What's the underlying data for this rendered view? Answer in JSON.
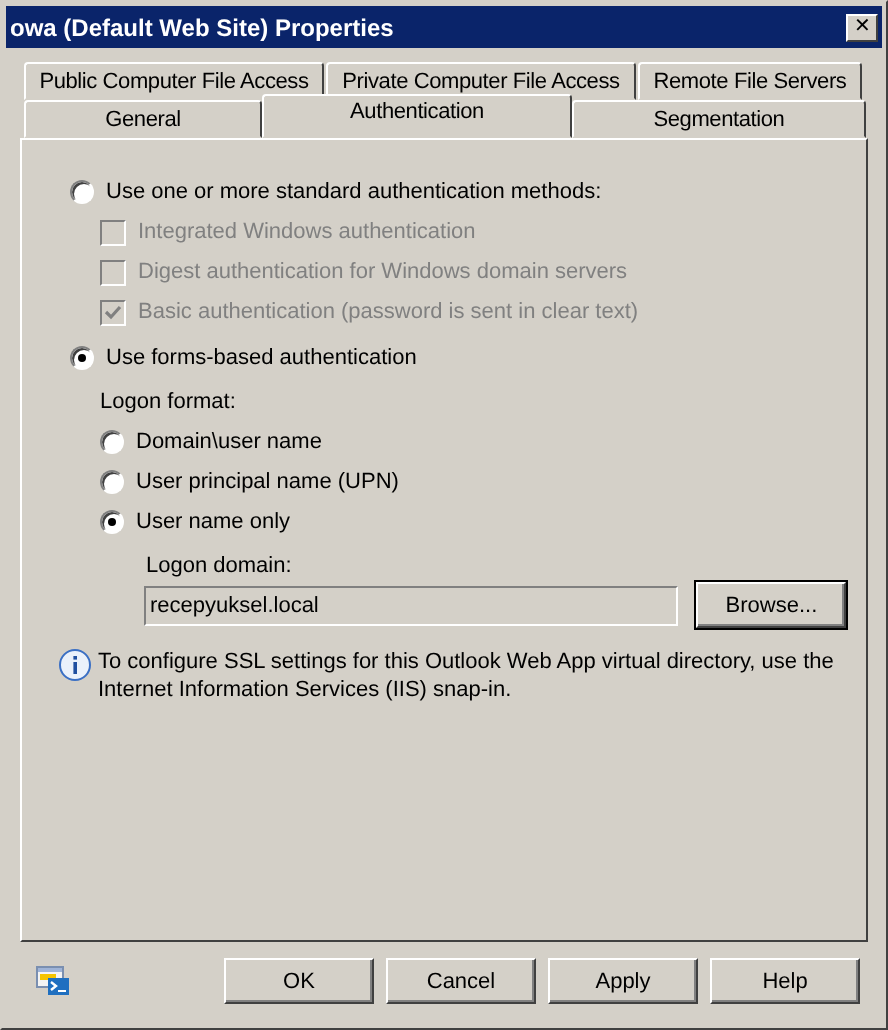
{
  "window": {
    "title": "owa (Default Web Site) Properties",
    "close": "✕"
  },
  "tab_rows": [
    [
      {
        "label": "Public Computer File Access",
        "selected": false
      },
      {
        "label": "Private Computer File Access",
        "selected": false
      },
      {
        "label": "Remote File Servers",
        "selected": false
      }
    ],
    [
      {
        "label": "General",
        "selected": false
      },
      {
        "label": "Authentication",
        "selected": true
      },
      {
        "label": "Segmentation",
        "selected": false
      }
    ]
  ],
  "auth_options": [
    {
      "label": "Use one or more standard authentication methods:",
      "selected": false,
      "methods": [
        {
          "label": "Integrated Windows authentication",
          "checked": false,
          "disabled": true
        },
        {
          "label": "Digest authentication for Windows domain servers",
          "checked": false,
          "disabled": true
        },
        {
          "label": "Basic authentication (password is sent in clear text)",
          "checked": true,
          "disabled": true
        }
      ]
    },
    {
      "label": "Use forms-based authentication",
      "selected": true
    }
  ],
  "logon_format": {
    "label": "Logon format:",
    "options": [
      {
        "label": "Domain\\user name",
        "selected": false
      },
      {
        "label": "User principal name (UPN)",
        "selected": false
      },
      {
        "label": "User name only",
        "selected": true
      }
    ]
  },
  "logon_domain": {
    "label": "Logon domain:",
    "value": "recepyuksel.local",
    "button": "Browse..."
  },
  "info": "To configure SSL settings for this Outlook Web App virtual directory, use the Internet Information Services (IIS) snap-in.",
  "buttons": [
    "OK",
    "Cancel",
    "Apply",
    "Help"
  ]
}
